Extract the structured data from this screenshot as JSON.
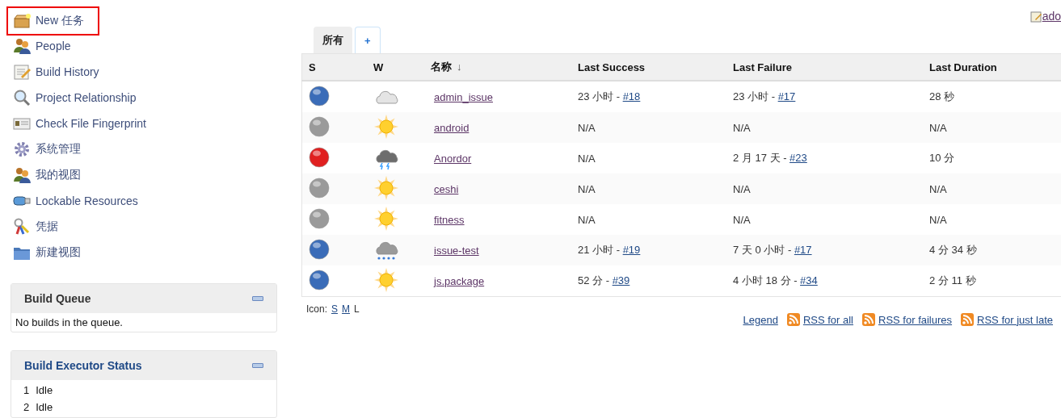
{
  "sidebar": {
    "tasks": [
      {
        "label": "New 任务",
        "kind": "box",
        "highlighted": true
      },
      {
        "label": "People",
        "kind": "people",
        "highlighted": false
      },
      {
        "label": "Build History",
        "kind": "notepad",
        "highlighted": false
      },
      {
        "label": "Project Relationship",
        "kind": "search",
        "highlighted": false
      },
      {
        "label": "Check File Fingerprint",
        "kind": "card",
        "highlighted": false
      },
      {
        "label": "系统管理",
        "kind": "gear",
        "highlighted": false
      },
      {
        "label": "我的视图",
        "kind": "people",
        "highlighted": false
      },
      {
        "label": "Lockable Resources",
        "kind": "usb",
        "highlighted": false
      },
      {
        "label": "凭据",
        "kind": "keys",
        "highlighted": false
      },
      {
        "label": "新建视图",
        "kind": "folder",
        "highlighted": false
      }
    ],
    "build_queue": {
      "title": "Build Queue",
      "message": "No builds in the queue."
    },
    "executor_status": {
      "title": "Build Executor Status",
      "executors": [
        {
          "number": "1",
          "status": "Idle"
        },
        {
          "number": "2",
          "status": "Idle"
        }
      ]
    }
  },
  "top_link": {
    "text": "ado"
  },
  "tabs": [
    {
      "label": "所有",
      "selected": true
    },
    {
      "label": "+",
      "selected": false
    }
  ],
  "table": {
    "columns": [
      {
        "label": "S"
      },
      {
        "label": "W"
      },
      {
        "label": "名称",
        "sort": "↓"
      },
      {
        "label": "Last Success"
      },
      {
        "label": "Last Failure"
      },
      {
        "label": "Last Duration"
      }
    ],
    "rows": [
      {
        "status": {
          "color": "#3a6cb8"
        },
        "weather": {
          "kind": "cloudy"
        },
        "name": "admin_issue",
        "last_success": {
          "text": "23 小时 -",
          "link": "#18"
        },
        "last_failure": {
          "text": "23 小时 -",
          "link": "#17"
        },
        "duration": "28 秒"
      },
      {
        "status": {
          "color": "#9a9a9a"
        },
        "weather": {
          "kind": "sunny"
        },
        "name": "android",
        "last_success": {
          "text": "N/A"
        },
        "last_failure": {
          "text": "N/A"
        },
        "duration": "N/A"
      },
      {
        "status": {
          "color": "#e02020"
        },
        "weather": {
          "kind": "storm"
        },
        "name": "Anordor",
        "last_success": {
          "text": "N/A"
        },
        "last_failure": {
          "text": "2 月 17 天 -",
          "link": "#23"
        },
        "duration": "10 分"
      },
      {
        "status": {
          "color": "#9a9a9a"
        },
        "weather": {
          "kind": "sunny"
        },
        "name": "ceshi",
        "last_success": {
          "text": "N/A"
        },
        "last_failure": {
          "text": "N/A"
        },
        "duration": "N/A"
      },
      {
        "status": {
          "color": "#9a9a9a"
        },
        "weather": {
          "kind": "sunny"
        },
        "name": "fitness",
        "last_success": {
          "text": "N/A"
        },
        "last_failure": {
          "text": "N/A"
        },
        "duration": "N/A"
      },
      {
        "status": {
          "color": "#3a6cb8"
        },
        "weather": {
          "kind": "rain"
        },
        "name": "issue-test",
        "last_success": {
          "text": "21 小时 -",
          "link": "#19"
        },
        "last_failure": {
          "text": "7 天 0 小时 -",
          "link": "#17"
        },
        "duration": "4 分 34 秒"
      },
      {
        "status": {
          "color": "#3a6cb8"
        },
        "weather": {
          "kind": "sunny"
        },
        "name": "js.package",
        "last_success": {
          "text": "52 分 -",
          "link": "#39"
        },
        "last_failure": {
          "text": "4 小时 18 分 -",
          "link": "#34"
        },
        "duration": "2 分 11 秒"
      }
    ]
  },
  "icon_size": {
    "label": "Icon:",
    "options": [
      {
        "label": "S",
        "selected": false
      },
      {
        "label": "M",
        "selected": false
      },
      {
        "label": "L",
        "selected": true
      }
    ]
  },
  "footer_links": [
    {
      "label": "Legend",
      "kind": "plain"
    },
    {
      "label": "RSS for all",
      "kind": "rss"
    },
    {
      "label": "RSS for failures",
      "kind": "rss"
    },
    {
      "label": "RSS for just late",
      "kind": "rss"
    }
  ]
}
